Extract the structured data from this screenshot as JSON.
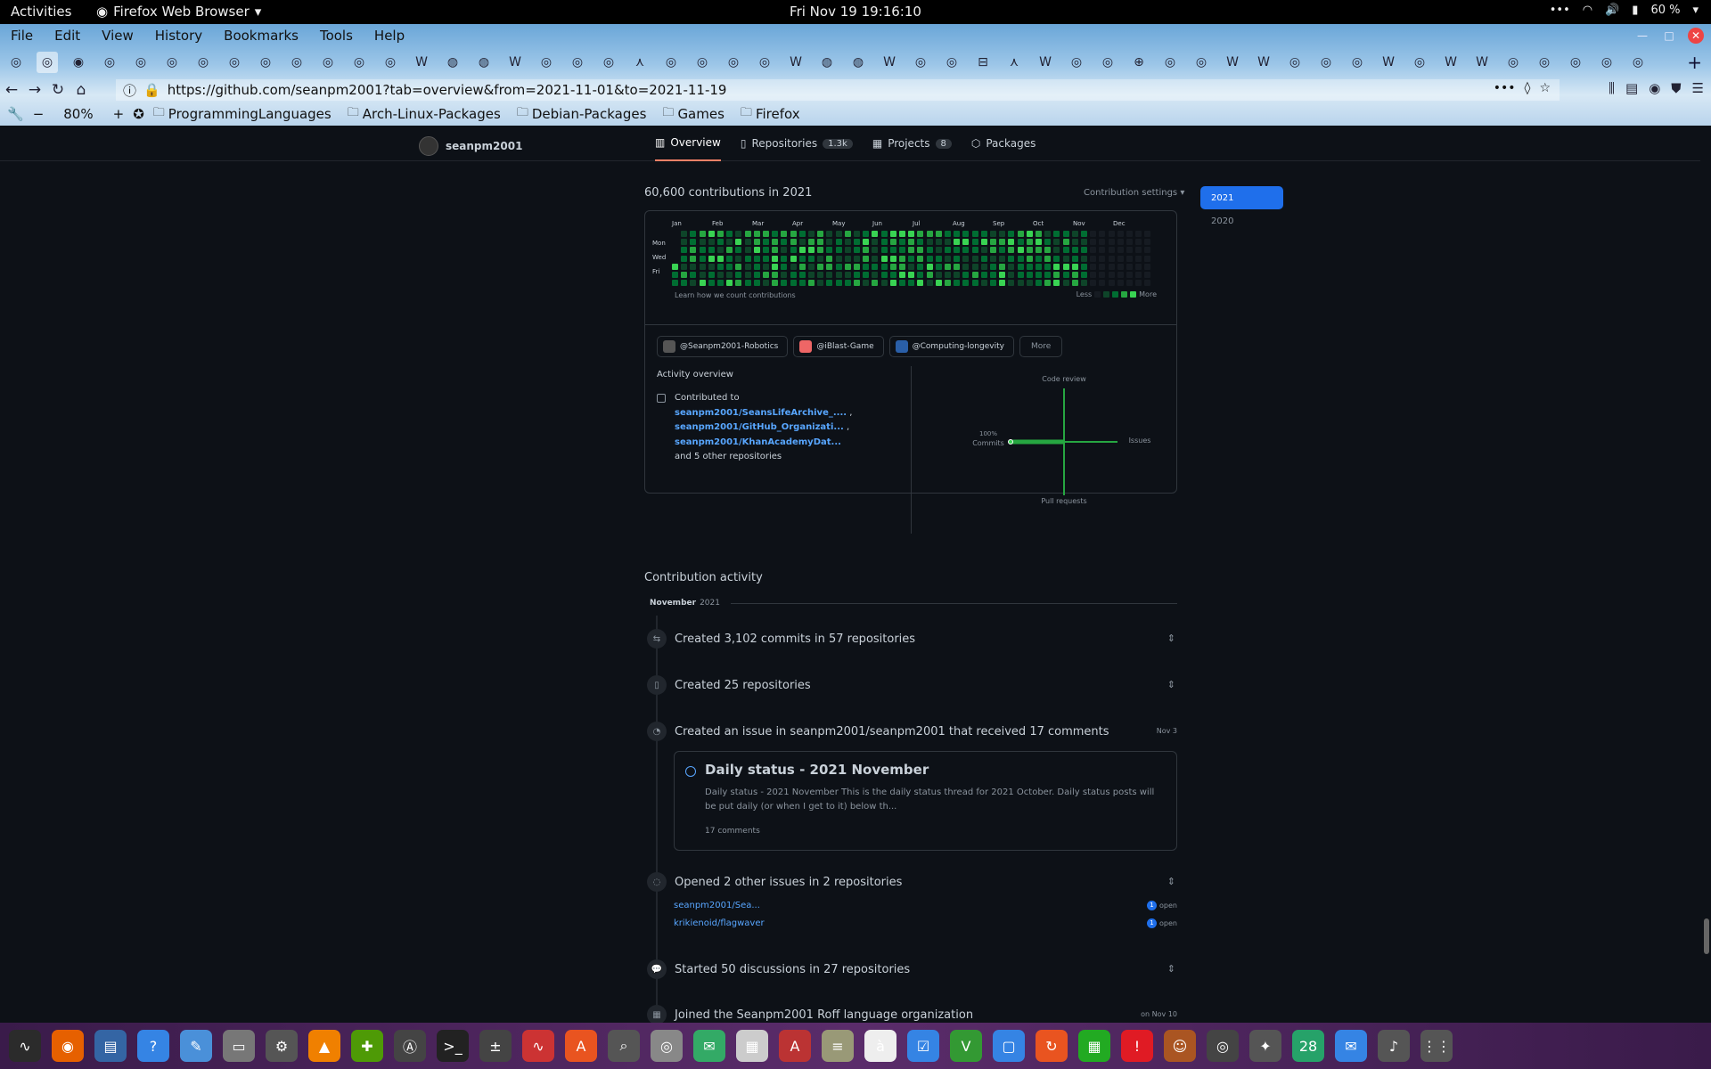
{
  "topbar": {
    "activities": "Activities",
    "app_name": "Firefox Web Browser",
    "clock": "Fri Nov 19  19:16:10",
    "battery": "60 %"
  },
  "menu": [
    "File",
    "Edit",
    "View",
    "History",
    "Bookmarks",
    "Tools",
    "Help"
  ],
  "tabs_count": 53,
  "url": "https://github.com/seanpm2001?tab=overview&from=2021-11-01&to=2021-11-19",
  "bookmarks": {
    "zoom": "80%",
    "folders": [
      "ProgrammingLanguages",
      "Arch-Linux-Packages",
      "Debian-Packages",
      "Games",
      "Firefox"
    ]
  },
  "profile": {
    "username": "seanpm2001",
    "tabs": [
      {
        "label": "Overview",
        "count": ""
      },
      {
        "label": "Repositories",
        "count": "1.3k"
      },
      {
        "label": "Projects",
        "count": "8"
      },
      {
        "label": "Packages",
        "count": ""
      }
    ]
  },
  "contributions": {
    "title": "60,600 contributions in 2021",
    "settings": "Contribution settings ▾",
    "years": [
      "2021",
      "2020"
    ],
    "months": [
      "Jan",
      "Feb",
      "Mar",
      "Apr",
      "May",
      "Jun",
      "Jul",
      "Aug",
      "Sep",
      "Oct",
      "Nov",
      "Dec"
    ],
    "days": [
      "Mon",
      "Wed",
      "Fri"
    ],
    "learn": "Learn how we count contributions",
    "legend_less": "Less",
    "legend_more": "More",
    "colors": [
      "#161b22",
      "#0e4429",
      "#006d32",
      "#26a641",
      "#39d353"
    ]
  },
  "activity": {
    "orgs": [
      {
        "name": "@Seanpm2001-Robotics",
        "color": "#555"
      },
      {
        "name": "@iBlast-Game",
        "color": "#e66"
      },
      {
        "name": "@Computing-longevity",
        "color": "#2a5fa8"
      }
    ],
    "more": "More",
    "title": "Activity overview",
    "contributed_to": "Contributed to",
    "repos": [
      "seanpm2001/SeansLifeArchive_....",
      "seanpm2001/GitHub_Organizati...",
      "seanpm2001/KhanAcademyDat..."
    ],
    "others": "and 5 other repositories",
    "axes": {
      "top": "Code review",
      "right": "Issues",
      "bottom": "Pull requests",
      "left_pct": "100%",
      "left": "Commits"
    },
    "commits_pct": 100
  },
  "contribution_activity": {
    "title": "Contribution activity",
    "month": "November",
    "year": "2021",
    "items": [
      {
        "text": "Created 3,102 commits in 57 repositories"
      },
      {
        "text": "Created 25 repositories"
      },
      {
        "text": "Created an issue in seanpm2001/seanpm2001 that received 17 comments",
        "date": "Nov 3"
      },
      {
        "text": "Opened 2 other issues in 2 repositories"
      },
      {
        "text": "Started 50 discussions in 27 repositories"
      },
      {
        "text": "Joined the Seanpm2001 Roff language organization",
        "date": "on Nov 10"
      }
    ],
    "issue": {
      "title": "Daily status - 2021 November",
      "body": "Daily status - 2021 November This is the daily status thread for 2021 October. Daily status posts will be put daily (or when I get to it) below th...",
      "comments": "17 comments"
    },
    "other_issues": [
      {
        "repo": "seanpm2001/Sea...",
        "count": "1",
        "state": "open"
      },
      {
        "repo": "krikienoid/flagwaver",
        "count": "1",
        "state": "open"
      }
    ]
  }
}
